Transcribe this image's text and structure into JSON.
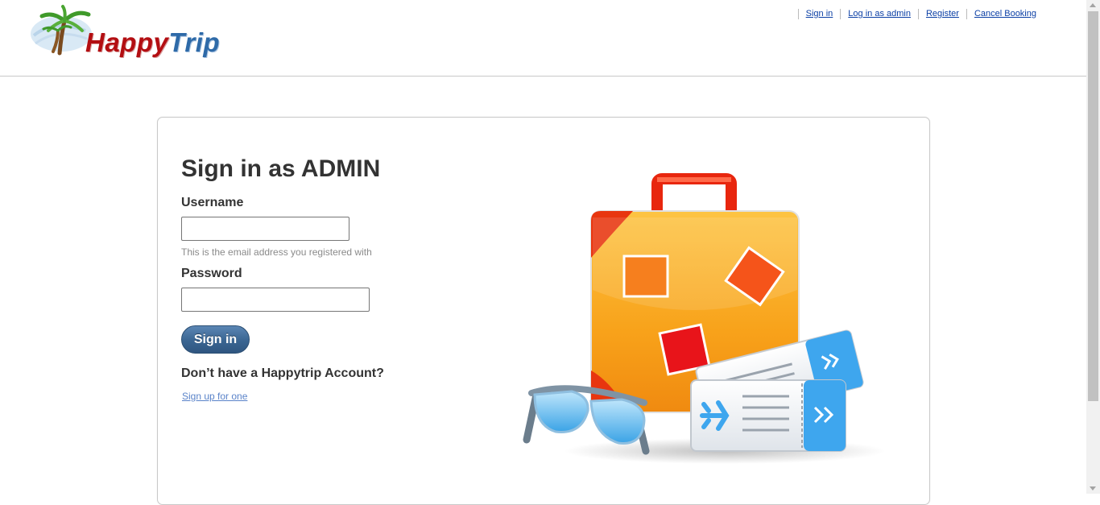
{
  "brand": {
    "logo_part1": "Happy",
    "logo_part2": "Trip"
  },
  "topnav": [
    {
      "label": "Sign in"
    },
    {
      "label": "Log in as admin"
    },
    {
      "label": "Register"
    },
    {
      "label": "Cancel Booking"
    }
  ],
  "form": {
    "title": "Sign in as ADMIN",
    "username_label": "Username",
    "username_value": "",
    "username_hint": "This is the email address you registered with",
    "password_label": "Password",
    "password_value": "",
    "submit_label": "Sign in",
    "no_account_text": "Don’t have a Happytrip Account?",
    "signup_link": "Sign up for one"
  },
  "colors": {
    "button": "#3a6592",
    "link": "#0b3fa5",
    "logo_red": "#b30e12",
    "logo_blue": "#2e6aa8",
    "suitcase": "#f7a21b"
  },
  "icons": [
    "palm-tree-icon",
    "suitcase-illustration",
    "sunglasses-icon",
    "plane-ticket-icon"
  ]
}
